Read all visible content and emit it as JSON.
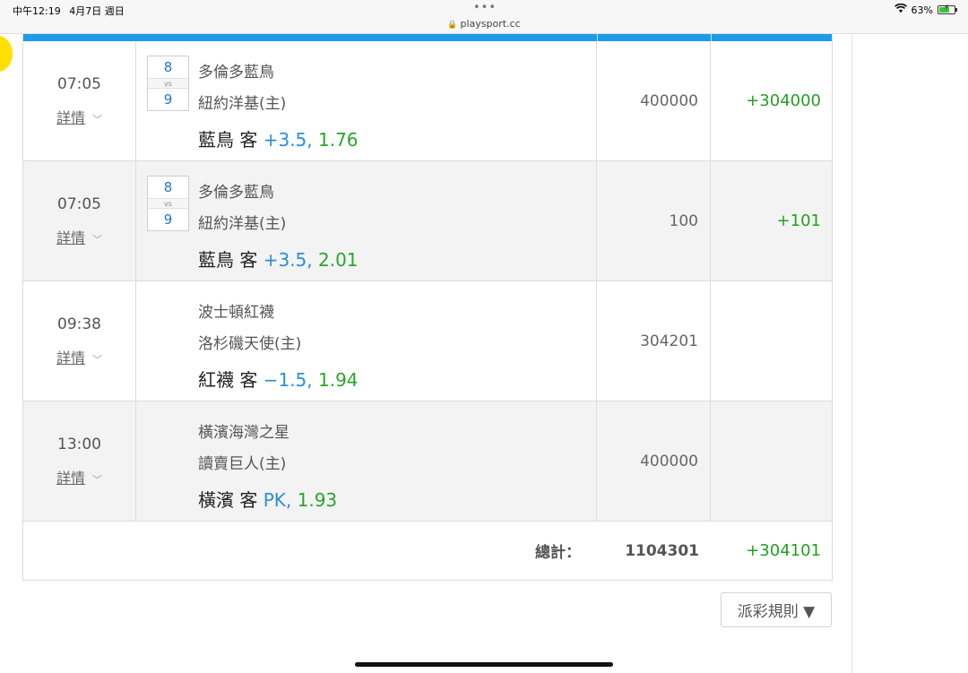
{
  "status_bar": {
    "time": "中午12:19",
    "date": "4月7日 週日",
    "url": "playsport.cc",
    "battery_percent": "63%"
  },
  "rows": [
    {
      "time": "07:05",
      "detail": "詳情",
      "score_away": "8",
      "vs": "vs",
      "score_home": "9",
      "away_team": "多倫多藍鳥",
      "home_team": "紐約洋基(主)",
      "pick_team": "藍鳥 客",
      "pick_line": "+3.5,",
      "pick_odds": "1.76",
      "bet": "400000",
      "win": "+304000"
    },
    {
      "time": "07:05",
      "detail": "詳情",
      "score_away": "8",
      "vs": "vs",
      "score_home": "9",
      "away_team": "多倫多藍鳥",
      "home_team": "紐約洋基(主)",
      "pick_team": "藍鳥 客",
      "pick_line": "+3.5,",
      "pick_odds": "2.01",
      "bet": "100",
      "win": "+101"
    },
    {
      "time": "09:38",
      "detail": "詳情",
      "away_team": "波士頓紅襪",
      "home_team": "洛杉磯天使(主)",
      "pick_team": "紅襪 客",
      "pick_line": "−1.5,",
      "pick_odds": "1.94",
      "bet": "304201",
      "win": ""
    },
    {
      "time": "13:00",
      "detail": "詳情",
      "away_team": "橫濱海灣之星",
      "home_team": "讀賣巨人(主)",
      "pick_team": "橫濱 客",
      "pick_line": "PK,",
      "pick_odds": "1.93",
      "bet": "400000",
      "win": ""
    }
  ],
  "total": {
    "label": "總計：",
    "bet": "1104301",
    "win": "+304101"
  },
  "rules_button": "派彩規則 ▼",
  "colors": {
    "accent_blue": "#1e9be6",
    "win_green": "#22a022",
    "line_blue": "#2b8fd8"
  }
}
